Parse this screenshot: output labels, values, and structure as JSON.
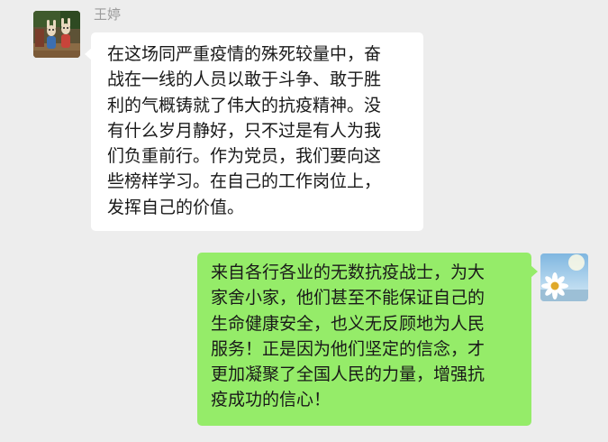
{
  "chat": {
    "messages": [
      {
        "sender": "王婷",
        "side": "left",
        "avatar_icon": "user-avatar-icon",
        "bubble_color": "#ffffff",
        "lines": [
          "在这场同严重疫情的殊死较量中，奋",
          "战在一线的人员以敢于斗争、敢于胜",
          "利的气概铸就了伟大的抗疫精神。没",
          "有什么岁月静好，只不过是有人为我",
          "们负重前行。作为党员，我们要向这",
          "些榜样学习。在自己的工作岗位上，",
          "发挥自己的价值。"
        ]
      },
      {
        "side": "right",
        "avatar_icon": "self-avatar-icon",
        "bubble_color": "#95ec69",
        "lines": [
          "来自各行各业的无数抗疫战士，为大",
          "家舍小家，他们甚至不能保证自己的",
          "生命健康安全，也义无反顾地为人民",
          "服务！正是因为他们坚定的信念，才",
          "更加凝聚了全国人民的力量，增强抗",
          "疫成功的信心！"
        ]
      }
    ]
  },
  "colors": {
    "background": "#ededed",
    "name_text": "#9b9b9b",
    "message_text": "#191919"
  }
}
